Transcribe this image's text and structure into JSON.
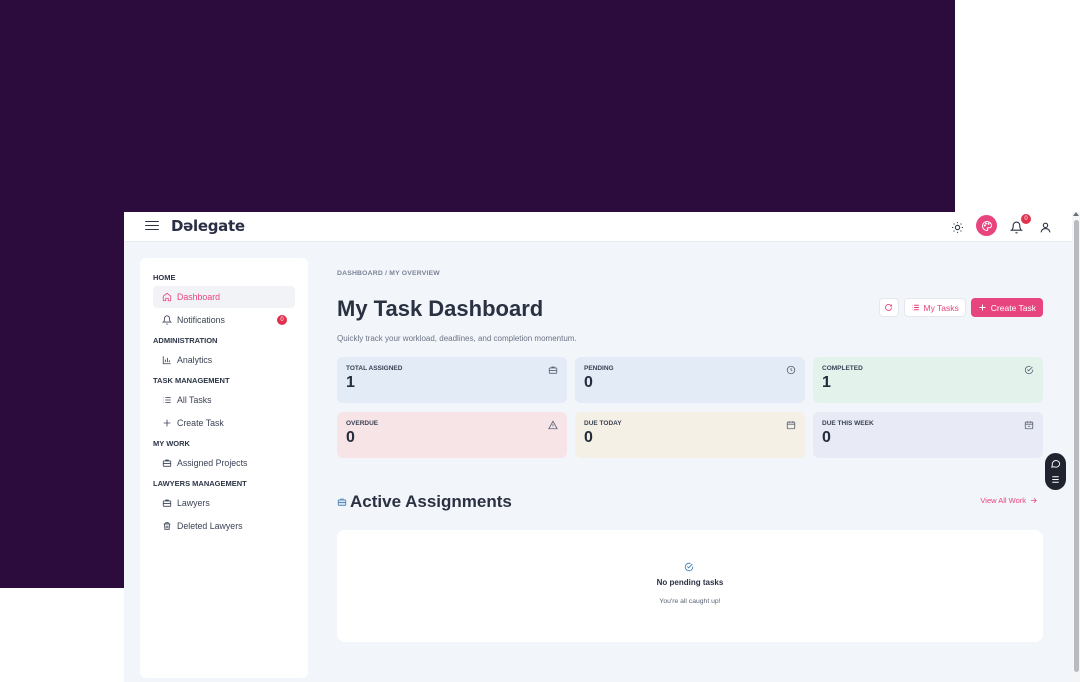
{
  "app": {
    "logo_text": "Dəlegate",
    "notification_count": "0"
  },
  "colors": {
    "accent": "#e8457f",
    "background_purple": "#2c0c3c",
    "card_total": "#e3ebf7",
    "card_pending": "#e3ebf7",
    "card_completed": "#e3f3ec",
    "card_overdue": "#f7e4e7",
    "card_due_today": "#f5f0e6",
    "card_due_week": "#e8eaf6"
  },
  "sidebar": {
    "sections": [
      {
        "label": "HOME",
        "items": [
          {
            "label": "Dashboard",
            "icon": "home-icon",
            "active": true
          },
          {
            "label": "Notifications",
            "icon": "bell-icon",
            "badge": "0"
          }
        ]
      },
      {
        "label": "ADMINISTRATION",
        "items": [
          {
            "label": "Analytics",
            "icon": "chart-icon"
          }
        ]
      },
      {
        "label": "TASK MANAGEMENT",
        "items": [
          {
            "label": "All Tasks",
            "icon": "list-icon"
          },
          {
            "label": "Create Task",
            "icon": "plus-icon"
          }
        ]
      },
      {
        "label": "MY WORK",
        "items": [
          {
            "label": "Assigned Projects",
            "icon": "briefcase-icon"
          }
        ]
      },
      {
        "label": "LAWYERS MANAGEMENT",
        "items": [
          {
            "label": "Lawyers",
            "icon": "briefcase-icon"
          },
          {
            "label": "Deleted Lawyers",
            "icon": "trash-icon"
          }
        ]
      }
    ]
  },
  "main": {
    "breadcrumb": "DASHBOARD / MY OVERVIEW",
    "title": "My Task Dashboard",
    "subtitle": "Quickly track your workload, deadlines, and completion momentum.",
    "actions": {
      "my_tasks_label": "My Tasks",
      "create_task_label": "Create Task"
    },
    "cards": [
      {
        "label": "TOTAL ASSIGNED",
        "value": "1",
        "icon": "briefcase-icon"
      },
      {
        "label": "PENDING",
        "value": "0",
        "icon": "clock-icon"
      },
      {
        "label": "COMPLETED",
        "value": "1",
        "icon": "check-circle-icon"
      },
      {
        "label": "OVERDUE",
        "value": "0",
        "icon": "warning-icon"
      },
      {
        "label": "DUE TODAY",
        "value": "0",
        "icon": "calendar-icon"
      },
      {
        "label": "DUE THIS WEEK",
        "value": "0",
        "icon": "calendar-icon"
      }
    ],
    "active_assignments": {
      "title": "Active Assignments",
      "view_all_label": "View All Work",
      "empty_title": "No pending tasks",
      "empty_subtitle": "You're all caught up!"
    }
  }
}
